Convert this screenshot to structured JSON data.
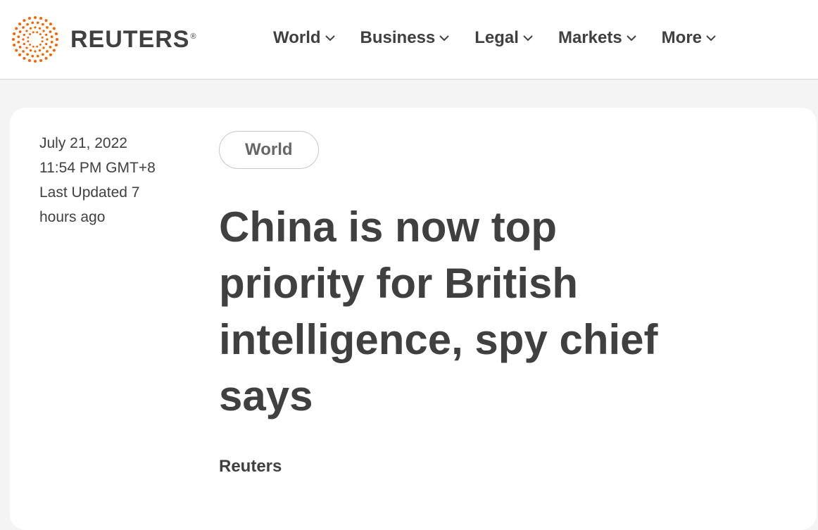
{
  "brand": {
    "name": "REUTERS",
    "registered_mark": "®",
    "accent_color": "#fa6400"
  },
  "nav": {
    "items": [
      {
        "label": "World",
        "icon": "chevron-down-icon"
      },
      {
        "label": "Business",
        "icon": "chevron-down-icon"
      },
      {
        "label": "Legal",
        "icon": "chevron-down-icon"
      },
      {
        "label": "Markets",
        "icon": "chevron-down-icon"
      },
      {
        "label": "More",
        "icon": "chevron-down-icon"
      }
    ]
  },
  "article": {
    "date": "July 21, 2022",
    "time": "11:54 PM GMT+8",
    "updated": "Last Updated 7 hours ago",
    "section_tag": "World",
    "headline": "China is now top priority for British intelligence, spy chief says",
    "byline": "Reuters"
  }
}
